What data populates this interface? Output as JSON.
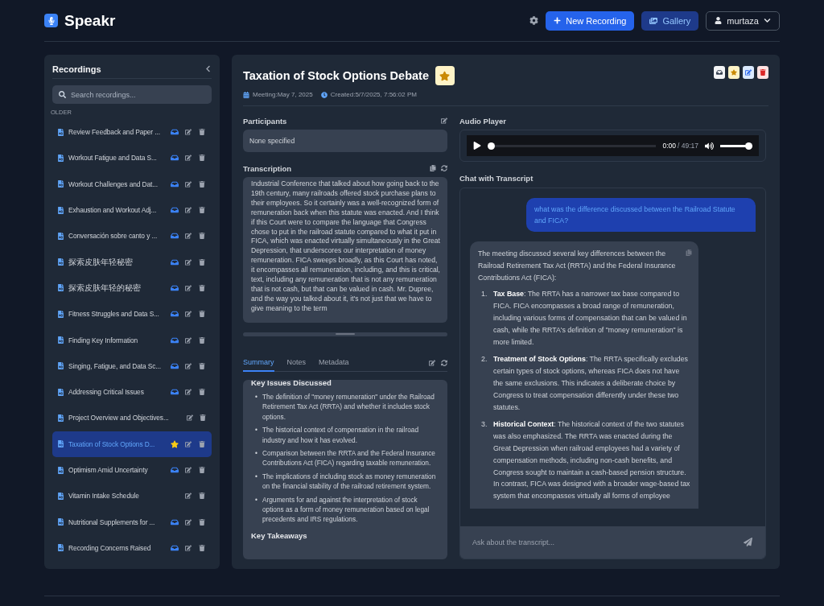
{
  "header": {
    "app_name": "Speakr",
    "new_recording": "New Recording",
    "gallery": "Gallery",
    "user": "murtaza"
  },
  "sidebar": {
    "title": "Recordings",
    "search": {
      "placeholder": "Search recordings..."
    },
    "group_label": "OLDER",
    "items": [
      {
        "title": "Review Feedback and Paper ...",
        "inbox": true,
        "starred": false,
        "selected": false
      },
      {
        "title": "Workout Fatigue and Data S...",
        "inbox": true,
        "starred": false,
        "selected": false
      },
      {
        "title": "Workout Challenges and Dat...",
        "inbox": true,
        "starred": false,
        "selected": false
      },
      {
        "title": "Exhaustion and Workout Adj...",
        "inbox": true,
        "starred": false,
        "selected": false
      },
      {
        "title": "Conversación sobre canto y ...",
        "inbox": true,
        "starred": false,
        "selected": false
      },
      {
        "title": "探索皮肤年轻秘密",
        "inbox": true,
        "starred": false,
        "selected": false
      },
      {
        "title": "探索皮肤年轻的秘密",
        "inbox": true,
        "starred": false,
        "selected": false
      },
      {
        "title": "Fitness Struggles and Data S...",
        "inbox": true,
        "starred": false,
        "selected": false
      },
      {
        "title": "Finding Key Information",
        "inbox": true,
        "starred": false,
        "selected": false
      },
      {
        "title": "Singing, Fatigue, and Data Sc...",
        "inbox": true,
        "starred": false,
        "selected": false
      },
      {
        "title": "Addressing Critical Issues",
        "inbox": true,
        "starred": false,
        "selected": false
      },
      {
        "title": "Project Overview and Objectives...",
        "inbox": false,
        "starred": false,
        "selected": false
      },
      {
        "title": "Taxation of Stock Options D...",
        "inbox": false,
        "starred": true,
        "selected": true
      },
      {
        "title": "Optimism Amid Uncertainty",
        "inbox": true,
        "starred": false,
        "selected": false
      },
      {
        "title": "Vitamin Intake Schedule",
        "inbox": false,
        "starred": false,
        "selected": false
      },
      {
        "title": "Nutritional Supplements for ...",
        "inbox": true,
        "starred": false,
        "selected": false
      },
      {
        "title": "Recording Concerns Raised",
        "inbox": true,
        "starred": false,
        "selected": false
      }
    ]
  },
  "recording": {
    "title": "Taxation of Stock Options Debate",
    "starred": true,
    "meeting": "Meeting:May 7, 2025",
    "created": "Created:5/7/2025, 7:56:02 PM",
    "participants_label": "Participants",
    "participants": "None specified",
    "transcription_label": "Transcription",
    "transcription": "Industrial Conference that talked about how going back to the 19th century, many railroads offered stock purchase plans to their employees. So it certainly was a well-recognized form of remuneration back when this statute was enacted. And I think if this Court were to compare the language that Congress chose to put in the railroad statute compared to what it put in FICA, which was enacted virtually simultaneously in the Great Depression, that underscores our interpretation of money remuneration. FICA sweeps broadly, as this Court has noted, it encompasses all remuneration, including, and this is critical, text, including any remuneration that is not any remuneration that is not cash, but that can be valued in cash. Mr. Dupree, and the way you talked about it, it's not just that we have to give meaning to the term",
    "tabs": [
      {
        "label": "Summary",
        "selected": true
      },
      {
        "label": "Notes",
        "selected": false
      },
      {
        "label": "Metadata",
        "selected": false
      }
    ],
    "summary": {
      "heading": "Key Issues Discussed",
      "bullet_marker": "•",
      "bullets": [
        "The definition of \"money remuneration\" under the Railroad Retirement Tax Act (RRTA) and whether it includes stock options.",
        "The historical context of compensation in the railroad industry and how it has evolved.",
        "Comparison between the RRTA and the Federal Insurance Contributions Act (FICA) regarding taxable remuneration.",
        "The implications of including stock as money remuneration on the financial stability of the railroad retirement system.",
        "Arguments for and against the interpretation of stock options as a form of money remuneration based on legal precedents and IRS regulations."
      ],
      "next_heading": "Key Takeaways"
    }
  },
  "audio": {
    "label": "Audio Player",
    "current": "0:00",
    "duration": "/ 49:17",
    "level": 0.0,
    "volume": {
      "level": 1.0
    }
  },
  "chat": {
    "label": "Chat with Transcript",
    "placeholder": "Ask about the transcript...",
    "messages": [
      {
        "kind": "user",
        "text": "what was the difference discussed between the Railroad Statute and FICA?"
      },
      {
        "kind": "assistant",
        "text": "The meeting discussed several key differences between the Railroad Retirement Tax Act (RRTA) and the Federal Insurance Contributions Act (FICA):",
        "points": [
          {
            "number": "1.",
            "text": "**Tax Base**: The RRTA has a narrower tax base compared to FICA. FICA encompasses a broad range of remuneration, including various forms of compensation that can be valued in cash, while the RRTA's definition of \"money remuneration\" is more limited."
          },
          {
            "number": "2.",
            "text": "**Treatment of Stock Options**: The RRTA specifically excludes certain types of stock options, whereas FICA does not have the same exclusions. This indicates a deliberate choice by Congress to treat compensation differently under these two statutes."
          },
          {
            "number": "3.",
            "text": "**Historical Context**: The historical context of the two statutes was also emphasized. The RRTA was enacted during the Great Depression when railroad employees had a variety of compensation methods, including non-cash benefits, and Congress sought to maintain a cash-based pension structure. In contrast, FICA was designed with a broader wage-based tax system that encompasses virtually all forms of employee"
          }
        ]
      }
    ]
  }
}
